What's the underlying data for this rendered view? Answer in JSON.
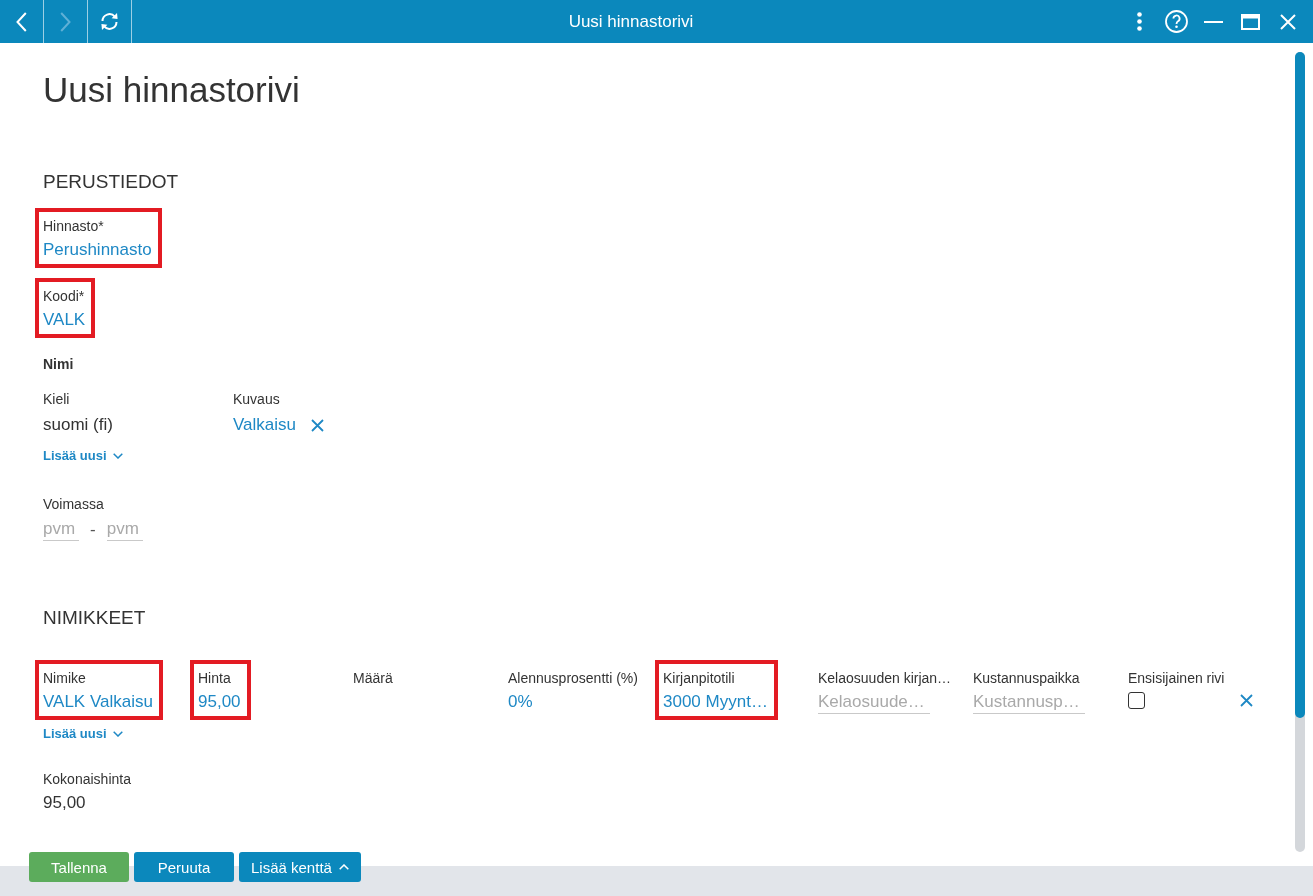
{
  "window": {
    "title": "Uusi hinnastorivi",
    "nav": [
      {
        "kind": "back",
        "disabled": false
      },
      {
        "kind": "forward",
        "disabled": true
      },
      {
        "kind": "refresh",
        "disabled": false
      }
    ],
    "controls": [
      {
        "kind": "more"
      },
      {
        "kind": "help"
      },
      {
        "kind": "minimize"
      },
      {
        "kind": "maximize"
      },
      {
        "kind": "close"
      }
    ]
  },
  "heading": "Uusi hinnastorivi",
  "basic": {
    "title": "PERUSTIEDOT",
    "fields": [
      {
        "label": "Hinnasto*",
        "value": "Perushinnasto",
        "highlighted": true
      },
      {
        "label": "Koodi*",
        "value": "VALK",
        "highlighted": true
      }
    ],
    "name": {
      "title": "Nimi",
      "columns": [
        "Kieli",
        "Kuvaus"
      ],
      "rows": [
        {
          "language": "suomi (fi)",
          "description": "Valkaisu",
          "removable": true
        }
      ],
      "add_new": "Lisää uusi"
    },
    "validity": {
      "label": "Voimassa",
      "from": {
        "placeholder": "pvm"
      },
      "separator": "-",
      "to": {
        "placeholder": "pvm"
      }
    }
  },
  "items": {
    "title": "NIMIKKEET",
    "fields": [
      {
        "kind": "value",
        "label": "Nimike",
        "value": "VALK Valkaisu",
        "highlighted": true
      },
      {
        "kind": "value",
        "label": "Hinta",
        "value": "95,00",
        "highlighted": true
      },
      {
        "kind": "empty",
        "label": "Määrä",
        "highlighted": false
      },
      {
        "kind": "value",
        "label": "Alennusprosentti (%)",
        "value": "0%",
        "highlighted": false
      },
      {
        "kind": "value",
        "label": "Kirjanpitotili",
        "value": "3000 Myynt…",
        "highlighted": true
      },
      {
        "kind": "input",
        "label": "Kelaosuuden kirjan…",
        "placeholder": "Kelaosuude…",
        "highlighted": false
      },
      {
        "kind": "input",
        "label": "Kustannuspaikka",
        "placeholder": "Kustannusp…",
        "highlighted": false
      },
      {
        "kind": "checkbox",
        "label": "Ensisijainen rivi",
        "checked": false,
        "highlighted": false
      }
    ],
    "removable": true,
    "add_new": "Lisää uusi",
    "total": {
      "label": "Kokonaishinta",
      "value": "95,00"
    }
  },
  "footer": {
    "buttons": [
      {
        "kind": "save",
        "label": "Tallenna"
      },
      {
        "kind": "cancel",
        "label": "Peruuta"
      },
      {
        "kind": "dropdown",
        "label": "Lisää kenttä"
      }
    ]
  }
}
